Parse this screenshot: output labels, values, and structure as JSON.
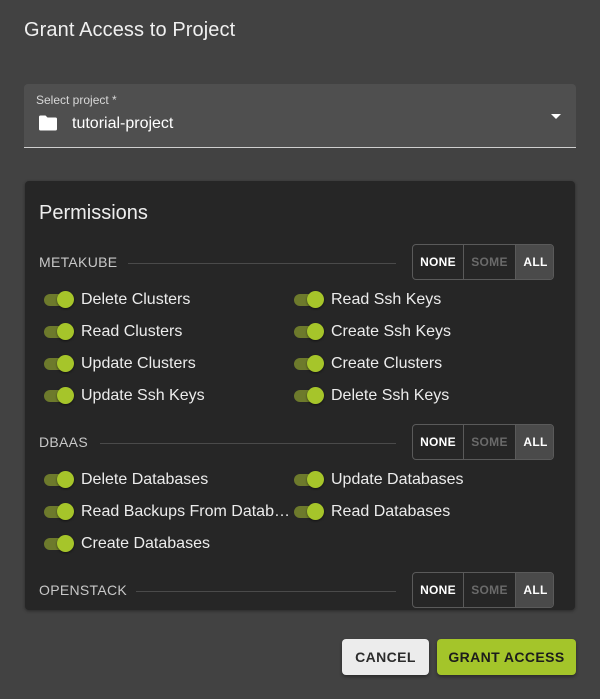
{
  "dialog": {
    "title": "Grant Access to Project"
  },
  "project_select": {
    "label": "Select project *",
    "value": "tutorial-project",
    "icon": "folder-icon"
  },
  "permissions": {
    "title": "Permissions",
    "sections": [
      {
        "name": "METAKUBE",
        "buttons": {
          "none": "NONE",
          "some": "SOME",
          "all": "ALL",
          "selected": "ALL"
        },
        "items": [
          {
            "label": "Delete Clusters",
            "enabled": true
          },
          {
            "label": "Read Ssh Keys",
            "enabled": true
          },
          {
            "label": "Read Clusters",
            "enabled": true
          },
          {
            "label": "Create Ssh Keys",
            "enabled": true
          },
          {
            "label": "Update Clusters",
            "enabled": true
          },
          {
            "label": "Create Clusters",
            "enabled": true
          },
          {
            "label": "Update Ssh Keys",
            "enabled": true
          },
          {
            "label": "Delete Ssh Keys",
            "enabled": true
          }
        ]
      },
      {
        "name": "DBAAS",
        "buttons": {
          "none": "NONE",
          "some": "SOME",
          "all": "ALL",
          "selected": "ALL"
        },
        "items": [
          {
            "label": "Delete Databases",
            "enabled": true
          },
          {
            "label": "Update Databases",
            "enabled": true
          },
          {
            "label": "Read Backups From Databa…",
            "enabled": true
          },
          {
            "label": "Read Databases",
            "enabled": true
          },
          {
            "label": "Create Databases",
            "enabled": true
          }
        ]
      },
      {
        "name": "OPENSTACK",
        "buttons": {
          "none": "NONE",
          "some": "SOME",
          "all": "ALL",
          "selected": "ALL"
        },
        "items": []
      }
    ]
  },
  "actions": {
    "cancel": "CANCEL",
    "grant": "GRANT ACCESS"
  },
  "colors": {
    "accent": "#a4c52a",
    "background": "#424242",
    "panel": "#262626"
  }
}
